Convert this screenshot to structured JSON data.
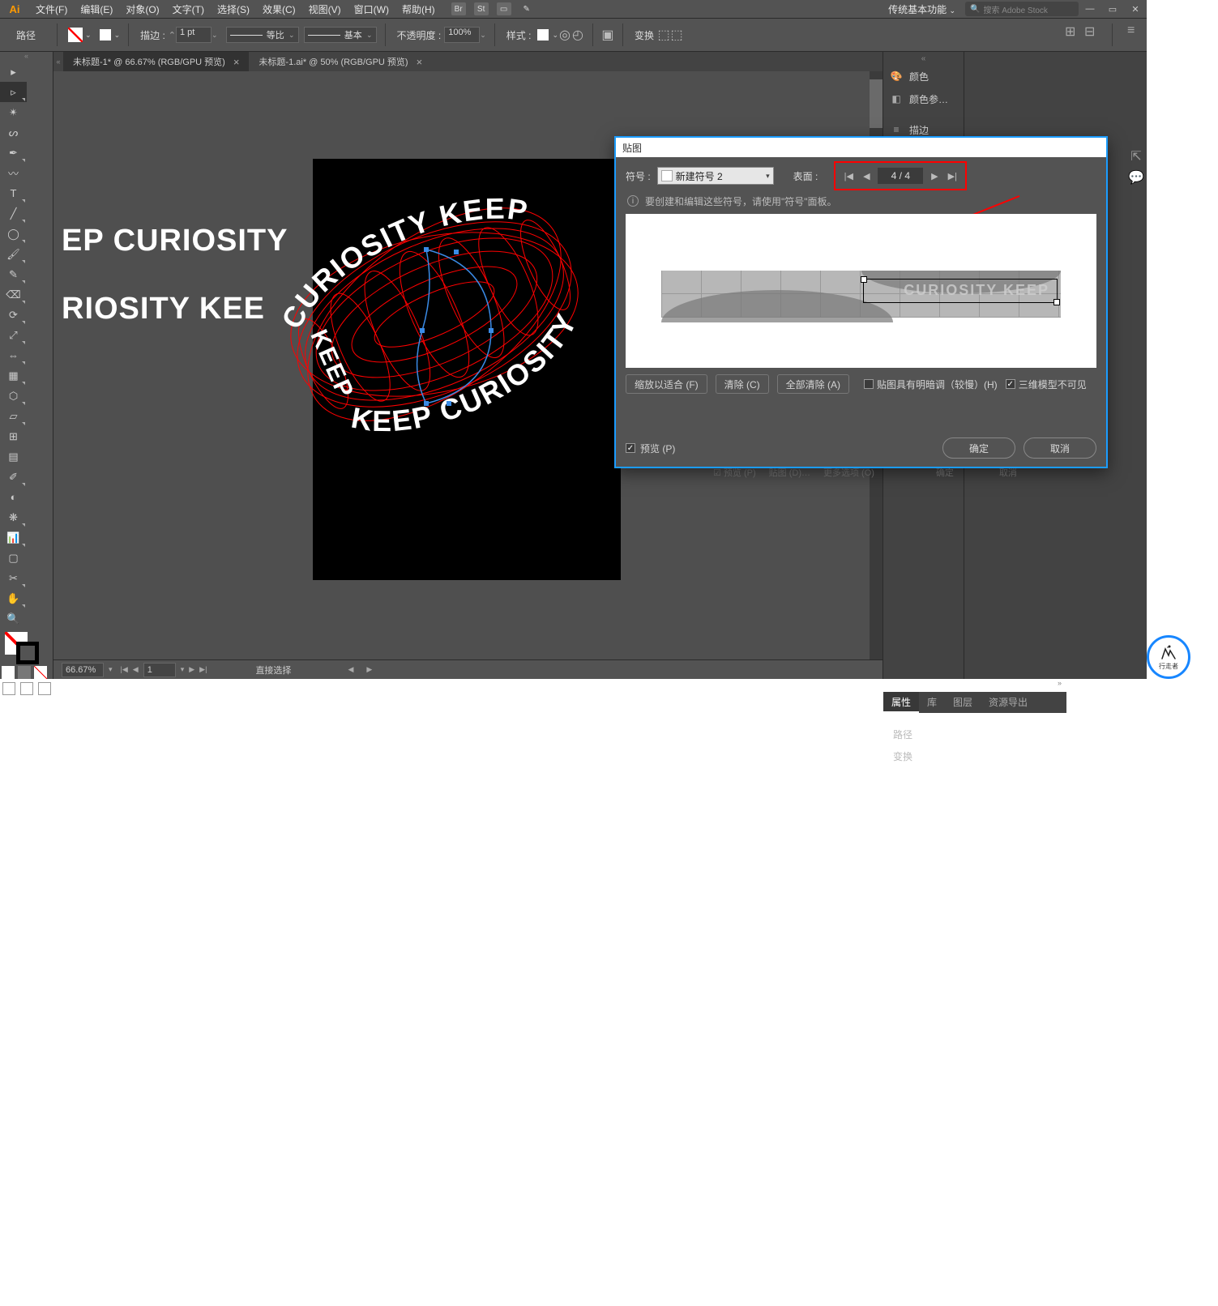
{
  "menu": {
    "file": "文件(F)",
    "edit": "编辑(E)",
    "object": "对象(O)",
    "type": "文字(T)",
    "select": "选择(S)",
    "effect": "效果(C)",
    "view": "视图(V)",
    "window": "窗口(W)",
    "help": "帮助(H)"
  },
  "titlebar": {
    "br": "Br",
    "st": "St",
    "workspace": "传统基本功能",
    "searchPlaceholder": "搜索 Adobe Stock"
  },
  "control": {
    "label": "路径",
    "stroke_label": "描边 :",
    "stroke_pt": "1 pt",
    "uniform": "等比",
    "basic": "基本",
    "opacity_label": "不透明度 :",
    "opacity": "100%",
    "style_label": "样式 :",
    "transform": "变换"
  },
  "tabs": [
    {
      "label": "未标题-1* @ 66.67% (RGB/GPU 预览)",
      "active": true
    },
    {
      "label": "未标题-1.ai* @ 50% (RGB/GPU 预览)",
      "active": false
    }
  ],
  "canvas": {
    "txt1": "EP CURIOSITY",
    "txt2": "RIOSITY KEE",
    "ring": "KEEP CURIOSITY KEEP CURIOSITY KEEP"
  },
  "status": {
    "zoom": "66.67%",
    "page": "1",
    "tool": "直接选择"
  },
  "midPanels": [
    {
      "icon": "🎨",
      "label": "颜色"
    },
    {
      "icon": "◧",
      "label": "颜色参…"
    },
    {
      "icon": "≡",
      "label": "描边"
    }
  ],
  "propTabs": {
    "p1": "属性",
    "p2": "库",
    "p3": "图层",
    "p4": "资源导出"
  },
  "propBody": {
    "sec1": "路径",
    "sec2": "变换"
  },
  "dialog": {
    "title": "贴图",
    "symbolLabel": "符号 :",
    "symbolValue": "新建符号 2",
    "surfaceLabel": "表面 :",
    "surface": "4 / 4",
    "info": "要创建和编辑这些符号，请使用\"符号\"面板。",
    "previewText": "CURIOSITY KEEP",
    "fit": "缩放以适合 (F)",
    "clear": "清除 (C)",
    "clearAll": "全部清除 (A)",
    "shade": "贴图具有明暗调（较慢）(H)",
    "invisible": "三维模型不可见",
    "preview": "预览 (P)",
    "ok": "确定",
    "cancel": "取消"
  },
  "behind": {
    "preview": "预览 (P)",
    "map": "贴图 (D)…",
    "more": "更多选项 (O)",
    "ok": "确定",
    "cancel": "取消"
  },
  "watermark": "行走者"
}
